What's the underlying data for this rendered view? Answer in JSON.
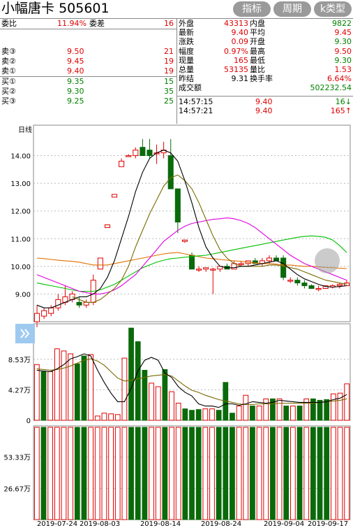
{
  "header": {
    "stock_name": "小幅唐卡",
    "stock_code": "505601",
    "buttons": [
      "指标",
      "周期",
      "k类型"
    ]
  },
  "order_book": {
    "wei_bi_label": "委比",
    "wei_bi_value": "11.94%",
    "wei_cha_label": "委差",
    "wei_cha_value": "16",
    "asks": [
      {
        "label": "卖③",
        "price": "9.50",
        "volume": "21"
      },
      {
        "label": "卖②",
        "price": "9.45",
        "volume": "19"
      },
      {
        "label": "卖①",
        "price": "9.40",
        "volume": "19"
      }
    ],
    "bids": [
      {
        "label": "买①",
        "price": "9.35",
        "volume": "15"
      },
      {
        "label": "买②",
        "price": "9.30",
        "volume": "35"
      },
      {
        "label": "买③",
        "price": "9.25",
        "volume": "25"
      }
    ]
  },
  "quote": {
    "rows": [
      {
        "l1": "外盘",
        "v1": "43313",
        "c1": "red",
        "l2": "内盘",
        "v2": "9822",
        "c2": "green"
      },
      {
        "l1": "最新",
        "v1": "9.40",
        "c1": "red",
        "l2": "平均",
        "v2": "9.45",
        "c2": "red"
      },
      {
        "l1": "涨跌",
        "v1": "0.09",
        "c1": "red",
        "l2": "开盘",
        "v2": "9.30",
        "c2": "green"
      },
      {
        "l1": "幅度",
        "v1": "0.97%",
        "c1": "red",
        "l2": "最高",
        "v2": "9.50",
        "c2": "red"
      },
      {
        "l1": "现量",
        "v1": "165",
        "c1": "red",
        "l2": "最低",
        "v2": "9.30",
        "c2": "green"
      },
      {
        "l1": "总量",
        "v1": "53135",
        "c1": "red",
        "l2": "量比",
        "v2": "1.53",
        "c2": "red"
      },
      {
        "l1": "昨结",
        "v1": "9.31",
        "c1": "black",
        "l2": "换手率",
        "v2": "6.64%",
        "c2": "red"
      },
      {
        "l1": "成交额",
        "v1": "",
        "c1": "black",
        "l2": "",
        "v2": "502232.54",
        "c2": "green"
      }
    ],
    "ticks": [
      {
        "time": "14:57:15",
        "price": "9.40",
        "volume": "16↓",
        "vcolor": "green"
      },
      {
        "time": "14:57:21",
        "price": "9.40",
        "volume": "165↑",
        "vcolor": "red"
      }
    ]
  },
  "chart_meta": {
    "period_label": "日线",
    "expand_icon": "double-chevron-right-icon"
  },
  "colors": {
    "up": "#e00000",
    "down": "#0a6a0a",
    "ma5": "#000000",
    "ma10": "#7a6a00",
    "ma20": "#e000e0",
    "ma30": "#00c000",
    "ma60": "#e07000"
  },
  "chart_data": [
    {
      "type": "candlestick",
      "title": "日线",
      "ylim": [
        8.0,
        15.1
      ],
      "yticks": [
        "14.00",
        "13.00",
        "12.00",
        "11.00",
        "10.00",
        "9.00"
      ],
      "xlabels": [
        "2019-07-24",
        "2019-08-03",
        "2019-08-14",
        "2019-08-24",
        "2019-09-04",
        "2019-09-17"
      ],
      "candles": [
        [
          8.0,
          8.6,
          7.8,
          8.3
        ],
        [
          8.2,
          8.5,
          8.1,
          8.4
        ],
        [
          8.3,
          8.6,
          8.2,
          8.5
        ],
        [
          8.5,
          9.0,
          8.4,
          8.8
        ],
        [
          8.7,
          9.3,
          8.6,
          8.9
        ],
        [
          8.8,
          9.1,
          8.7,
          9.0
        ],
        [
          8.7,
          8.9,
          8.5,
          8.6
        ],
        [
          8.6,
          8.8,
          8.5,
          8.7
        ],
        [
          8.7,
          9.7,
          8.6,
          9.5
        ],
        [
          9.9,
          10.3,
          9.9,
          10.3
        ],
        [
          11.4,
          11.5,
          11.4,
          11.5
        ],
        [
          12.5,
          12.6,
          12.5,
          12.6
        ],
        [
          13.6,
          13.9,
          13.6,
          13.8
        ],
        [
          14.0,
          14.05,
          13.95,
          14.0
        ],
        [
          14.0,
          14.3,
          13.9,
          14.2
        ],
        [
          14.3,
          14.6,
          14.0,
          14.0
        ],
        [
          14.2,
          14.6,
          13.9,
          14.0
        ],
        [
          14.1,
          14.4,
          13.7,
          14.1
        ],
        [
          14.1,
          14.5,
          13.9,
          14.2
        ],
        [
          14.0,
          14.6,
          13.2,
          12.8
        ],
        [
          12.8,
          12.8,
          11.2,
          11.6
        ],
        [
          10.9,
          10.95,
          10.85,
          10.95
        ],
        [
          10.4,
          10.5,
          9.9,
          9.9
        ],
        [
          9.9,
          10.0,
          9.8,
          9.9
        ],
        [
          9.9,
          9.95,
          9.8,
          9.95
        ],
        [
          9.9,
          9.95,
          9.0,
          9.9
        ],
        [
          9.9,
          10.0,
          9.8,
          10.0
        ],
        [
          10.0,
          10.1,
          9.9,
          9.9
        ],
        [
          9.9,
          10.2,
          9.9,
          10.1
        ],
        [
          10.1,
          10.2,
          10.0,
          10.1
        ],
        [
          10.1,
          10.2,
          10.0,
          10.2
        ],
        [
          10.2,
          10.3,
          10.1,
          10.1
        ],
        [
          10.1,
          10.3,
          10.0,
          10.2
        ],
        [
          10.2,
          10.4,
          10.1,
          10.3
        ],
        [
          10.3,
          10.4,
          10.2,
          10.2
        ],
        [
          10.3,
          10.4,
          9.5,
          9.6
        ],
        [
          9.5,
          9.6,
          9.4,
          9.5
        ],
        [
          9.5,
          9.6,
          9.3,
          9.4
        ],
        [
          9.4,
          9.5,
          9.2,
          9.3
        ],
        [
          9.3,
          9.35,
          9.2,
          9.2
        ],
        [
          9.2,
          9.3,
          9.1,
          9.2
        ],
        [
          9.2,
          9.3,
          9.2,
          9.3
        ],
        [
          9.25,
          9.35,
          9.2,
          9.3
        ],
        [
          9.3,
          9.4,
          9.2,
          9.35
        ],
        [
          9.3,
          9.5,
          9.3,
          9.4
        ]
      ],
      "ma5": [
        8.6,
        8.5,
        8.5,
        8.6,
        8.7,
        8.8,
        8.9,
        8.9,
        9.0,
        9.2,
        9.6,
        10.2,
        11.0,
        11.8,
        12.7,
        13.4,
        13.9,
        14.1,
        14.2,
        14.1,
        13.8,
        13.1,
        12.3,
        11.4,
        10.7,
        10.3,
        10.0,
        9.95,
        9.95,
        10.0,
        10.0,
        10.05,
        10.1,
        10.15,
        10.2,
        10.1,
        9.9,
        9.7,
        9.55,
        9.45,
        9.35,
        9.27,
        9.25,
        9.27,
        9.3
      ],
      "ma10": [
        null,
        null,
        null,
        null,
        null,
        8.9,
        8.8,
        8.7,
        8.7,
        8.8,
        9.0,
        9.2,
        9.5,
        10.0,
        10.7,
        11.3,
        11.9,
        12.4,
        12.9,
        13.2,
        13.3,
        13.1,
        12.8,
        12.3,
        11.7,
        11.1,
        10.6,
        10.3,
        10.1,
        10.0,
        10.0,
        10.0,
        10.0,
        10.05,
        10.05,
        10.0,
        9.95,
        9.9,
        9.8,
        9.7,
        9.6,
        9.5,
        9.45,
        9.4,
        9.35
      ],
      "ma20": [
        9.7,
        9.6,
        9.5,
        9.4,
        9.3,
        9.2,
        9.1,
        9.05,
        9.0,
        9.0,
        9.05,
        9.15,
        9.3,
        9.5,
        9.7,
        10.0,
        10.3,
        10.6,
        10.9,
        11.1,
        11.3,
        11.45,
        11.55,
        11.6,
        11.65,
        11.7,
        11.72,
        11.75,
        11.72,
        11.65,
        11.55,
        11.4,
        11.2,
        11.0,
        10.8,
        10.6,
        10.4,
        10.25,
        10.1,
        10.0,
        9.9,
        9.8,
        9.7,
        9.6,
        9.5
      ],
      "ma30": [
        9.4,
        9.35,
        9.3,
        9.25,
        9.2,
        9.15,
        9.1,
        9.1,
        9.1,
        9.15,
        9.25,
        9.35,
        9.5,
        9.65,
        9.8,
        9.95,
        10.05,
        10.15,
        10.22,
        10.28,
        10.3,
        10.33,
        10.35,
        10.38,
        10.4,
        10.45,
        10.5,
        10.55,
        10.6,
        10.65,
        10.7,
        10.75,
        10.8,
        10.85,
        10.9,
        10.95,
        11.0,
        11.05,
        11.08,
        11.1,
        11.08,
        11.05,
        10.95,
        10.75,
        10.5
      ],
      "ma60": [
        10.3,
        10.28,
        10.25,
        10.22,
        10.2,
        10.18,
        10.15,
        10.1,
        10.05,
        10.05,
        10.05,
        10.1,
        10.15,
        10.2,
        10.25,
        10.3,
        10.35,
        10.4,
        10.45,
        10.48,
        10.5,
        10.45,
        10.4,
        10.35,
        10.3,
        10.28,
        10.25,
        10.22,
        10.2,
        10.18,
        10.15,
        10.12,
        10.1,
        10.1,
        10.08,
        10.05,
        10.05,
        10.02,
        10.0,
        10.0,
        9.98,
        9.96,
        9.95,
        9.93,
        9.92
      ]
    },
    {
      "type": "bar",
      "title": "volume",
      "ylim": [
        0,
        13.5
      ],
      "yticks": [
        "8.53万",
        "4.27万",
        "0"
      ],
      "values": [
        7.8,
        6.8,
        6.8,
        10.0,
        9.7,
        9.3,
        7.9,
        9.0,
        9.2,
        0.6,
        1.0,
        0.9,
        0.8,
        8.7,
        12.9,
        11.0,
        7.0,
        5.2,
        4.7,
        7.1,
        4.0,
        2.4,
        1.6,
        1.4,
        1.5,
        1.6,
        1.6,
        1.4,
        5.3,
        1.0,
        2.0,
        3.5,
        2.0,
        2.0,
        3.0,
        3.0,
        3.0,
        2.0,
        2.0,
        2.0,
        3.0,
        3.0,
        2.8,
        2.9,
        3.7,
        3.8,
        5.1
      ],
      "up": [
        1,
        0,
        1,
        1,
        1,
        1,
        0,
        0,
        1,
        1,
        1,
        1,
        1,
        1,
        0,
        0,
        0,
        1,
        1,
        0,
        1,
        1,
        0,
        0,
        0,
        1,
        1,
        0,
        0,
        0,
        1,
        1,
        0,
        1,
        1,
        0,
        1,
        0,
        1,
        0,
        1,
        0,
        0,
        0,
        1,
        1,
        1
      ],
      "ma5": [
        7.0,
        6.9,
        6.8,
        7.2,
        7.8,
        8.6,
        8.9,
        9.3,
        9.0,
        7.0,
        5.3,
        3.8,
        2.6,
        2.6,
        4.5,
        6.9,
        8.4,
        8.8,
        8.4,
        6.6,
        6.0,
        4.7,
        3.9,
        3.4,
        2.3,
        2.0,
        2.0,
        1.8,
        2.3,
        2.3,
        2.1,
        2.3,
        2.6,
        2.5,
        2.4,
        2.5,
        2.8,
        2.7,
        2.6,
        2.5,
        2.5,
        2.5,
        2.5,
        2.6,
        2.9,
        3.1,
        3.6
      ],
      "ma10": [
        7.2,
        7.1,
        7.0,
        7.1,
        7.3,
        7.6,
        8.0,
        8.4,
        8.6,
        8.3,
        7.7,
        6.8,
        5.9,
        5.5,
        5.6,
        5.8,
        6.0,
        6.2,
        6.3,
        6.4,
        6.2,
        5.5,
        4.8,
        4.2,
        3.9,
        3.5,
        3.2,
        2.9,
        2.7,
        2.5,
        2.3,
        2.2,
        2.2,
        2.3,
        2.3,
        2.3,
        2.4,
        2.4,
        2.4,
        2.4,
        2.4,
        2.4,
        2.5,
        2.6,
        2.7,
        2.8,
        3.0
      ]
    },
    {
      "type": "bar",
      "title": "indicator",
      "ylim": [
        0,
        80
      ],
      "yticks": [
        "53.33万",
        "26.67万"
      ],
      "up": [
        1,
        0,
        1,
        1,
        1,
        1,
        0,
        0,
        1,
        1,
        1,
        1,
        1,
        1,
        0,
        0,
        0,
        1,
        1,
        0,
        1,
        1,
        0,
        0,
        0,
        1,
        1,
        0,
        0,
        0,
        1,
        1,
        0,
        1,
        1,
        0,
        1,
        0,
        1,
        0,
        1,
        0,
        0,
        0,
        1,
        1,
        1
      ]
    }
  ]
}
